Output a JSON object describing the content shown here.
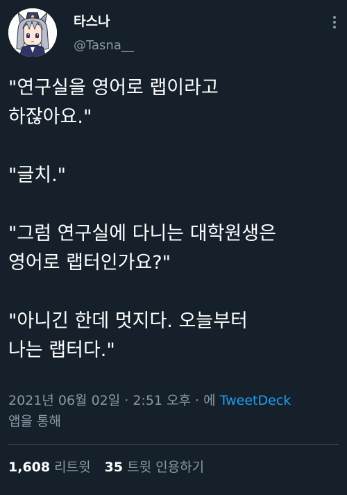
{
  "user": {
    "display_name": "타스나",
    "handle": "@Tasna__"
  },
  "tweet": {
    "paragraphs": [
      [
        "\"연구실을 영어로 랩이라고",
        "하잖아요.\""
      ],
      [
        "\"글치.\""
      ],
      [
        "\"그럼 연구실에 다니는 대학원생은",
        "영어로 랩터인가요?\""
      ],
      [
        "\"아니긴 한데 멋지다. 오늘부터",
        "나는 랩터다.\""
      ]
    ]
  },
  "meta": {
    "timestamp": "2021년 06월 02일 · 2:51 오후 · 에",
    "via_app": "TweetDeck",
    "via_suffix": "앱을 통해"
  },
  "stats": {
    "retweets_count": "1,608",
    "retweets_label": "리트윗",
    "quotes_count": "35",
    "quotes_label": "트윗 인용하기"
  },
  "icons": {
    "more": "more-vertical-icon",
    "avatar": "avatar-image"
  },
  "colors": {
    "background": "#15202b",
    "text": "#ffffff",
    "secondary": "#8899a6",
    "link": "#1da1f2",
    "divider": "#38444d"
  }
}
